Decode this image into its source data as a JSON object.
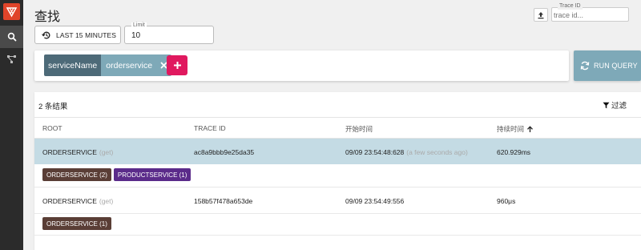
{
  "sidebar": {
    "items": [
      {
        "name": "search",
        "icon": "search-icon"
      },
      {
        "name": "dependencies",
        "icon": "dependencies-icon"
      }
    ]
  },
  "header": {
    "title": "查找",
    "trace_id_label": "Trace ID",
    "trace_id_placeholder": "trace id..."
  },
  "controls": {
    "time_range_label": "LAST 15 MINUTES",
    "limit_label": "Limit",
    "limit_value": "10"
  },
  "query": {
    "chip_key": "serviceName",
    "chip_value": "orderservice",
    "run_label": "RUN QUERY"
  },
  "results": {
    "count_label": "2 条结果",
    "filter_label": "过滤",
    "columns": [
      "ROOT",
      "TRACE ID",
      "开始时间",
      "持续时间"
    ],
    "rows": [
      {
        "root": "ORDERSERVICE",
        "method": "(get)",
        "trace_id": "ac8a9bbb9e25da35",
        "start": "09/09 23:54:48:628",
        "start_relative": "(a few seconds ago)",
        "duration": "620.929ms",
        "tags": [
          "ORDERSERVICE (2)",
          "PRODUCTSERVICE (1)"
        ]
      },
      {
        "root": "ORDERSERVICE",
        "method": "(get)",
        "trace_id": "158b57f478a653de",
        "start": "09/09 23:54:49:556",
        "start_relative": "",
        "duration": "960μs",
        "tags": [
          "ORDERSERVICE (1)"
        ]
      }
    ]
  },
  "colors": {
    "sidebar_bg": "#2b2b2b",
    "logo": "#e0442a",
    "chip_key": "#4d6a78",
    "chip_value": "#7ea9b8",
    "add_button": "#e0195f",
    "run_button": "#7ea9b8",
    "selected_row": "#c4dbe4",
    "tag_orderservice": "#5a3e36",
    "tag_productservice": "#5b2b8a"
  }
}
